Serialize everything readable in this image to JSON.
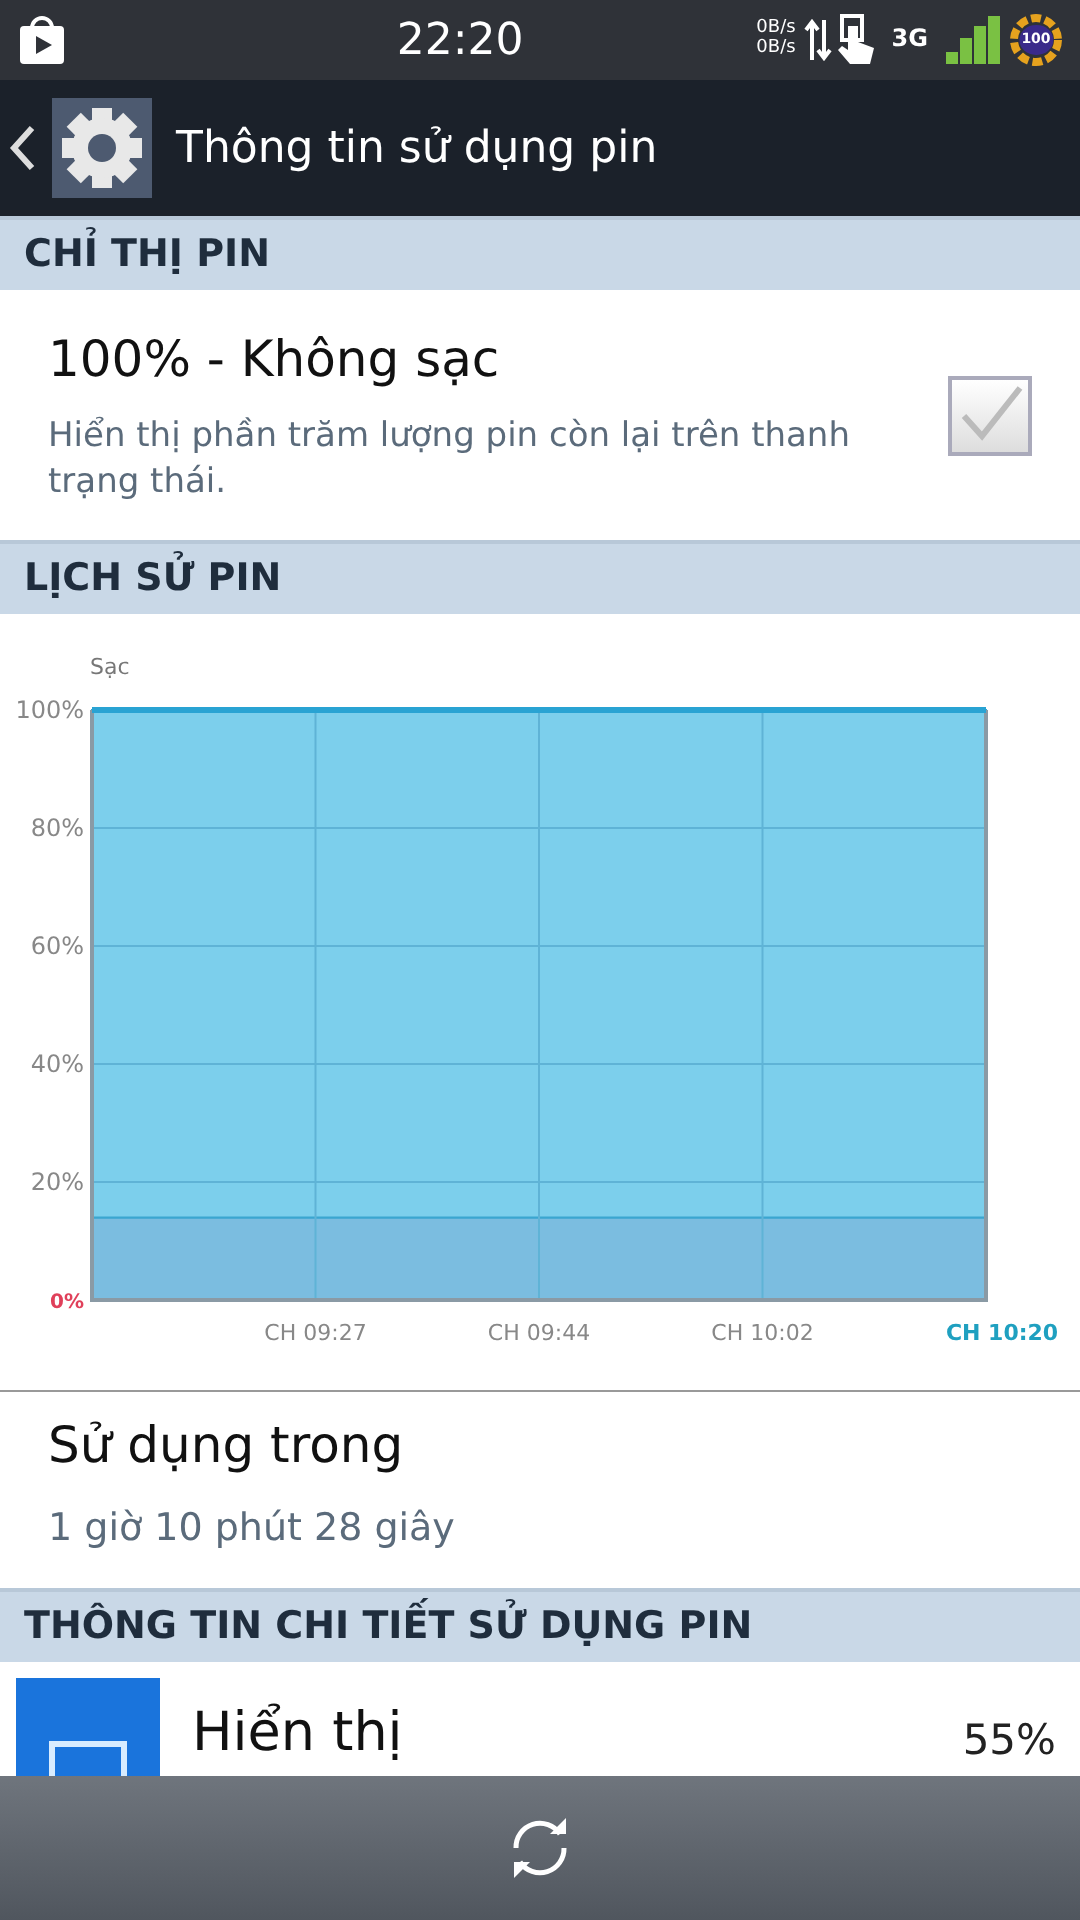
{
  "status_bar": {
    "time": "22:20",
    "upload_speed": "0B/s",
    "download_speed": "0B/s",
    "network": "3G",
    "battery": "100"
  },
  "action_bar": {
    "title": "Thông tin sử dụng pin"
  },
  "sections": [
    {
      "header": "CHỈ THỊ PIN",
      "kind": "toggle",
      "title": "100% - Không sạc",
      "summary": "Hiển thị phần trăm lượng pin còn lại trên thanh trạng thái.",
      "checked": true
    },
    {
      "header": "LỊCH SỬ PIN",
      "kind": "chart",
      "chart_data": {
        "type": "area",
        "ylabel": "Sạc",
        "categories": [
          null,
          "CH 09:27",
          "CH 09:44",
          "CH 10:02",
          "CH 10:20"
        ],
        "series": [
          {
            "color": "#7bbde0",
            "values": [
              14,
              14,
              14,
              14,
              14
            ]
          },
          {
            "color": "#7ccfec",
            "values": [
              86,
              86,
              86,
              86,
              86
            ]
          }
        ],
        "ylim": [
          0,
          100
        ],
        "grid": true,
        "yticks": [
          {
            "value": 0,
            "label": "0%"
          },
          {
            "value": 20,
            "label": "20%"
          },
          {
            "value": 40,
            "label": "40%"
          },
          {
            "value": 60,
            "label": "60%"
          },
          {
            "value": 80,
            "label": "80%"
          },
          {
            "value": 100,
            "label": "100%"
          }
        ],
        "stacked": true
      },
      "usage_title": "Sử dụng trong",
      "usage_time": "1 giờ 10 phút 28 giây"
    },
    {
      "header": "THÔNG TIN CHI TIẾT SỬ DỤNG PIN",
      "kind": "list",
      "items": [
        {
          "name": "Hiển thị",
          "percent": "55%"
        }
      ]
    }
  ]
}
